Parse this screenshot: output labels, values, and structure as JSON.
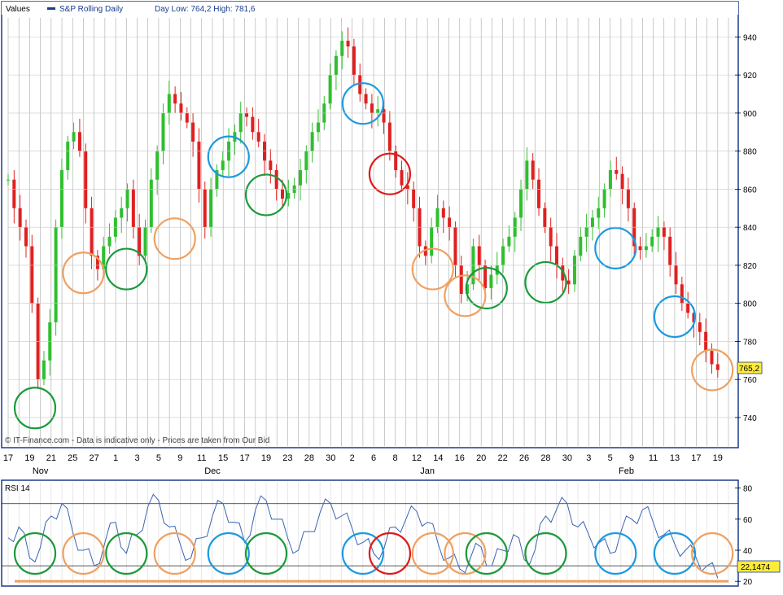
{
  "header": {
    "values_label": "Values",
    "series_label": "S&P Rolling Daily",
    "low_high_text": "Day Low: 764,2 High: 781,6"
  },
  "price_panel": {
    "watermark": "© IT-Finance.com - Data is indicative only - Prices are taken from Our Bid",
    "last_value_label": "765,2"
  },
  "rsi_panel": {
    "title": "RSI 14",
    "last_value_label": "22,1474"
  },
  "colors": {
    "background": "#ffffff",
    "grid": "#a8a8a8",
    "up_candle": "#2fbf2f",
    "down_candle": "#e02020",
    "rsi_line": "#3a64b4",
    "rsi_baseline": "#f0a060",
    "circle_green": "#1a9a3a",
    "circle_orange": "#f0a060",
    "circle_blue": "#1c9ae0",
    "circle_red": "#e01818",
    "axis_frame": "#1a3c8c"
  },
  "chart_data": [
    {
      "type": "candlestick",
      "title": "S&P Rolling Daily",
      "ylim": [
        725,
        950
      ],
      "y_ticks": [
        740,
        760,
        780,
        800,
        820,
        840,
        860,
        880,
        900,
        920,
        940
      ],
      "x_tick_labels": [
        "17",
        "19",
        "21",
        "25",
        "27",
        "1",
        "3",
        "5",
        "9",
        "11",
        "15",
        "17",
        "19",
        "23",
        "28",
        "30",
        "2",
        "6",
        "8",
        "12",
        "14",
        "16",
        "20",
        "22",
        "26",
        "28",
        "30",
        "3",
        "5",
        "9",
        "11",
        "13",
        "17",
        "19"
      ],
      "month_labels": [
        "Nov",
        "Dec",
        "Jan",
        "Feb"
      ],
      "last_value": 765.2,
      "day_low": 764.2,
      "day_high": 781.6,
      "close_path_days": [
        0,
        1,
        2,
        3,
        4,
        5,
        6,
        7,
        8,
        9,
        10,
        11,
        12,
        13,
        14,
        15,
        16,
        17,
        18,
        19,
        20,
        21,
        22,
        23,
        24,
        25,
        26,
        27,
        28,
        29,
        30,
        31,
        32,
        33,
        34,
        35,
        36,
        37,
        38,
        39,
        40,
        41,
        42,
        43,
        44,
        45,
        46,
        47,
        48,
        49,
        50,
        51,
        52,
        53,
        54,
        55,
        56,
        57,
        58,
        59,
        60,
        61,
        62,
        63,
        64,
        65,
        66,
        67,
        68,
        69,
        70,
        71,
        72,
        73,
        74,
        75,
        76,
        77,
        78,
        79,
        80,
        81,
        82,
        83,
        84,
        85,
        86,
        87,
        88,
        89,
        90,
        91,
        92,
        93,
        94,
        95,
        96,
        97,
        98,
        99,
        100,
        101,
        102,
        103,
        104,
        105,
        106,
        107,
        108,
        109,
        110,
        111,
        112,
        113,
        114,
        115,
        116,
        117,
        118,
        119
      ],
      "close_path_values": [
        865,
        850,
        840,
        830,
        800,
        760,
        770,
        790,
        840,
        870,
        885,
        890,
        880,
        850,
        825,
        818,
        830,
        835,
        845,
        850,
        860,
        840,
        825,
        840,
        865,
        880,
        900,
        910,
        905,
        900,
        895,
        885,
        860,
        840,
        860,
        870,
        875,
        885,
        890,
        900,
        898,
        890,
        885,
        875,
        870,
        860,
        855,
        858,
        862,
        870,
        880,
        890,
        895,
        905,
        920,
        930,
        938,
        935,
        920,
        910,
        905,
        900,
        902,
        895,
        880,
        870,
        862,
        860,
        850,
        830,
        825,
        840,
        850,
        845,
        840,
        820,
        805,
        810,
        830,
        820,
        808,
        815,
        820,
        830,
        835,
        845,
        860,
        875,
        865,
        850,
        840,
        830,
        820,
        812,
        810,
        825,
        835,
        840,
        845,
        850,
        860,
        870,
        868,
        860,
        850,
        830,
        828,
        830,
        835,
        840,
        835,
        820,
        810,
        800,
        795,
        790,
        785,
        775,
        768,
        765
      ],
      "annotation_circles": [
        {
          "color": "green",
          "day": 5,
          "value": 745
        },
        {
          "color": "orange",
          "day": 14,
          "value": 816
        },
        {
          "color": "green",
          "day": 22,
          "value": 818
        },
        {
          "color": "orange",
          "day": 31,
          "value": 834
        },
        {
          "color": "blue",
          "day": 41,
          "value": 877
        },
        {
          "color": "green",
          "day": 48,
          "value": 857
        },
        {
          "color": "blue",
          "day": 66,
          "value": 905
        },
        {
          "color": "red",
          "day": 71,
          "value": 868
        },
        {
          "color": "orange",
          "day": 79,
          "value": 818
        },
        {
          "color": "orange",
          "day": 85,
          "value": 804
        },
        {
          "color": "green",
          "day": 89,
          "value": 808
        },
        {
          "color": "green",
          "day": 100,
          "value": 811
        },
        {
          "color": "blue",
          "day": 113,
          "value": 829
        },
        {
          "color": "blue",
          "day": 124,
          "value": 793
        },
        {
          "color": "orange",
          "day": 131,
          "value": 765
        }
      ]
    },
    {
      "type": "line",
      "title": "RSI 14",
      "ylim": [
        18,
        84
      ],
      "y_ticks": [
        20,
        40,
        60,
        80
      ],
      "reference_lines": [
        30,
        70
      ],
      "last_value": 22.1474,
      "x_days": [
        0,
        2,
        4,
        6,
        8,
        10,
        12,
        14,
        16,
        18,
        20,
        22,
        24,
        26,
        28,
        30,
        32,
        34,
        36,
        38,
        40,
        42,
        44,
        46,
        48,
        50,
        52,
        54,
        56,
        58,
        60,
        62,
        64,
        66,
        68,
        70,
        72,
        74,
        76,
        78,
        80,
        82,
        84,
        86,
        88,
        90,
        92,
        94,
        96,
        98,
        100,
        102,
        104,
        106,
        108,
        110,
        112,
        114,
        116,
        118,
        120,
        122,
        124,
        126,
        128,
        130,
        132
      ],
      "values": [
        48,
        55,
        35,
        42,
        62,
        70,
        52,
        40,
        30,
        45,
        58,
        38,
        50,
        68,
        72,
        55,
        44,
        35,
        48,
        62,
        70,
        58,
        45,
        66,
        72,
        60,
        48,
        40,
        52,
        64,
        70,
        62,
        54,
        45,
        38,
        42,
        55,
        60,
        65,
        58,
        44,
        35,
        28,
        35,
        42,
        30,
        40,
        50,
        34,
        40,
        62,
        66,
        70,
        55,
        50,
        45,
        38,
        52,
        60,
        66,
        58,
        50,
        44,
        40,
        35,
        30,
        22
      ],
      "annotation_circles": [
        {
          "color": "green",
          "day": 5
        },
        {
          "color": "orange",
          "day": 14
        },
        {
          "color": "green",
          "day": 22
        },
        {
          "color": "orange",
          "day": 31
        },
        {
          "color": "blue",
          "day": 41
        },
        {
          "color": "green",
          "day": 48
        },
        {
          "color": "blue",
          "day": 66
        },
        {
          "color": "red",
          "day": 71
        },
        {
          "color": "orange",
          "day": 79
        },
        {
          "color": "orange",
          "day": 85
        },
        {
          "color": "green",
          "day": 89
        },
        {
          "color": "green",
          "day": 100
        },
        {
          "color": "blue",
          "day": 113
        },
        {
          "color": "blue",
          "day": 124
        },
        {
          "color": "orange",
          "day": 131
        }
      ]
    }
  ]
}
